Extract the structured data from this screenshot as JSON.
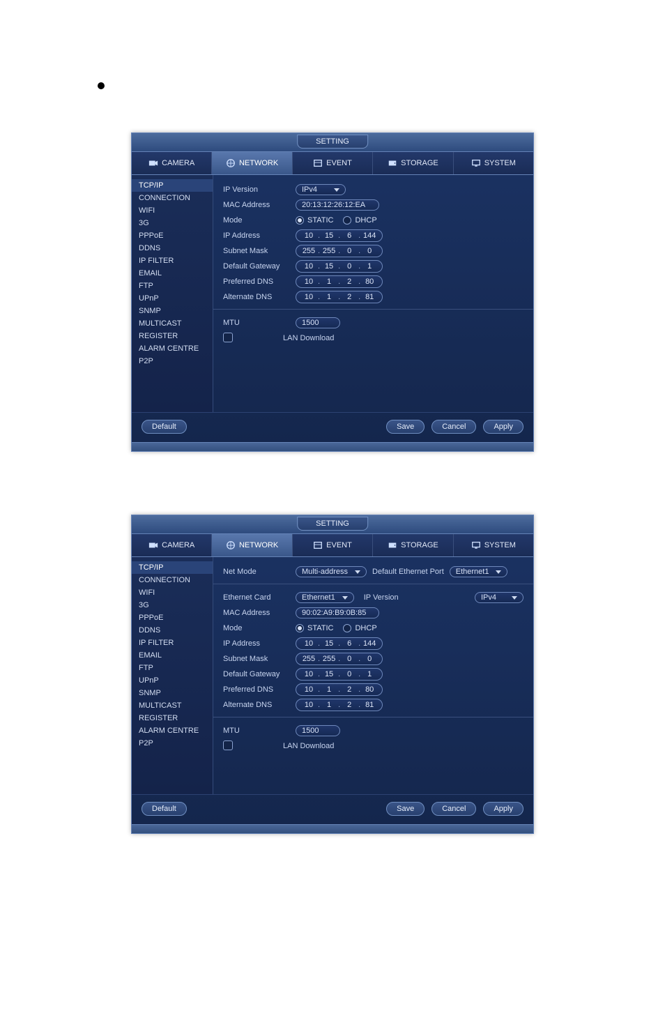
{
  "window_title": "SETTING",
  "tabs": {
    "camera": "CAMERA",
    "network": "NETWORK",
    "event": "EVENT",
    "storage": "STORAGE",
    "system": "SYSTEM"
  },
  "sidebar_items": [
    "TCP/IP",
    "CONNECTION",
    "WIFI",
    "3G",
    "PPPoE",
    "DDNS",
    "IP FILTER",
    "EMAIL",
    "FTP",
    "UPnP",
    "SNMP",
    "MULTICAST",
    "REGISTER",
    "ALARM CENTRE",
    "P2P"
  ],
  "net1": {
    "labels": {
      "ip_version": "IP Version",
      "mac": "MAC Address",
      "mode": "Mode",
      "ip": "IP Address",
      "subnet": "Subnet Mask",
      "gateway": "Default Gateway",
      "pref_dns": "Preferred DNS",
      "alt_dns": "Alternate DNS",
      "mtu": "MTU",
      "lan": "LAN Download",
      "static": "STATIC",
      "dhcp": "DHCP"
    },
    "ip_version": "IPv4",
    "mac": "20:13:12:26:12:EA",
    "ip": [
      "10",
      "15",
      "6",
      "144"
    ],
    "subnet": [
      "255",
      "255",
      "0",
      "0"
    ],
    "gateway": [
      "10",
      "15",
      "0",
      "1"
    ],
    "pref_dns": [
      "10",
      "1",
      "2",
      "80"
    ],
    "alt_dns": [
      "10",
      "1",
      "2",
      "81"
    ],
    "mtu": "1500"
  },
  "net2": {
    "labels": {
      "net_mode": "Net Mode",
      "def_port_lbl": "Default Ethernet Port",
      "eth_card": "Ethernet Card",
      "ip_version": "IP Version",
      "mac": "MAC Address",
      "mode": "Mode",
      "ip": "IP Address",
      "subnet": "Subnet Mask",
      "gateway": "Default Gateway",
      "pref_dns": "Preferred DNS",
      "alt_dns": "Alternate DNS",
      "mtu": "MTU",
      "lan": "LAN Download",
      "static": "STATIC",
      "dhcp": "DHCP"
    },
    "net_mode": "Multi-address",
    "def_port": "Ethernet1",
    "eth_card": "Ethernet1",
    "ip_version": "IPv4",
    "mac": "90:02:A9:B9:0B:85",
    "ip": [
      "10",
      "15",
      "6",
      "144"
    ],
    "subnet": [
      "255",
      "255",
      "0",
      "0"
    ],
    "gateway": [
      "10",
      "15",
      "0",
      "1"
    ],
    "pref_dns": [
      "10",
      "1",
      "2",
      "80"
    ],
    "alt_dns": [
      "10",
      "1",
      "2",
      "81"
    ],
    "mtu": "1500"
  },
  "buttons": {
    "default": "Default",
    "save": "Save",
    "cancel": "Cancel",
    "apply": "Apply"
  }
}
